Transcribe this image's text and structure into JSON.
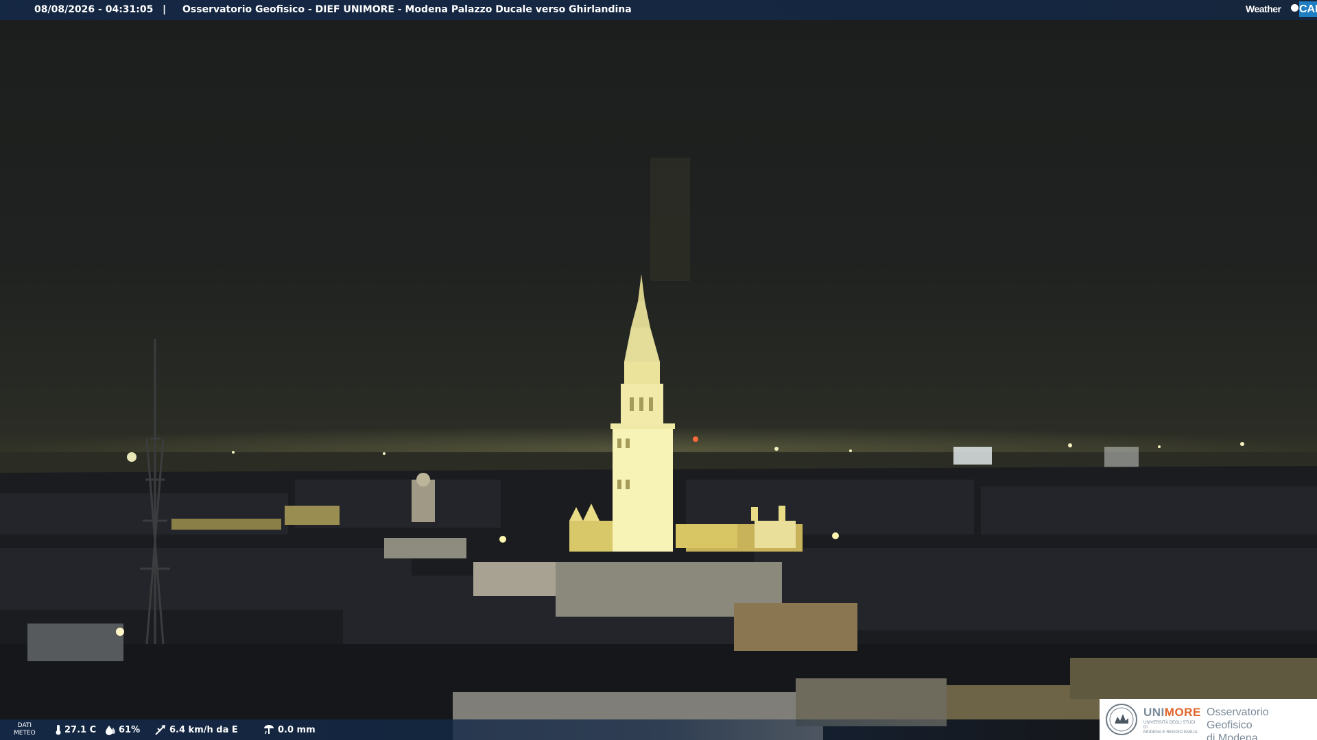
{
  "header": {
    "timestamp": "08/08/2026 - 04:31:05",
    "separator": "|",
    "title": "Osservatorio Geofisico - DIEF UNIMORE - Modena Palazzo Ducale verso Ghirlandina"
  },
  "brand_logo": {
    "word": "Weather",
    "suffix": "CAM",
    "accent_color": "#1f7dc2"
  },
  "weather": {
    "section_label_line1": "DATI",
    "section_label_line2": "METEO",
    "temperature": "27.1 C",
    "humidity": "61%",
    "wind": "6.4 km/h da E",
    "rain": "0.0 mm",
    "icons": [
      "thermometer-icon",
      "humidity-drops-icon",
      "wind-vane-icon",
      "rain-gauge-icon"
    ]
  },
  "footer_logo": {
    "brand_part1": "UNI",
    "brand_part2": "MORE",
    "university_line1": "UNIVERSITÀ DEGLI STUDI DI",
    "university_line2": "MODENA E REGGIO EMILIA",
    "observatory_line1": "Osservatorio Geofisico",
    "observatory_line2": "di Modena",
    "accent_color": "#e0652a",
    "text_color": "#7a8a99"
  }
}
